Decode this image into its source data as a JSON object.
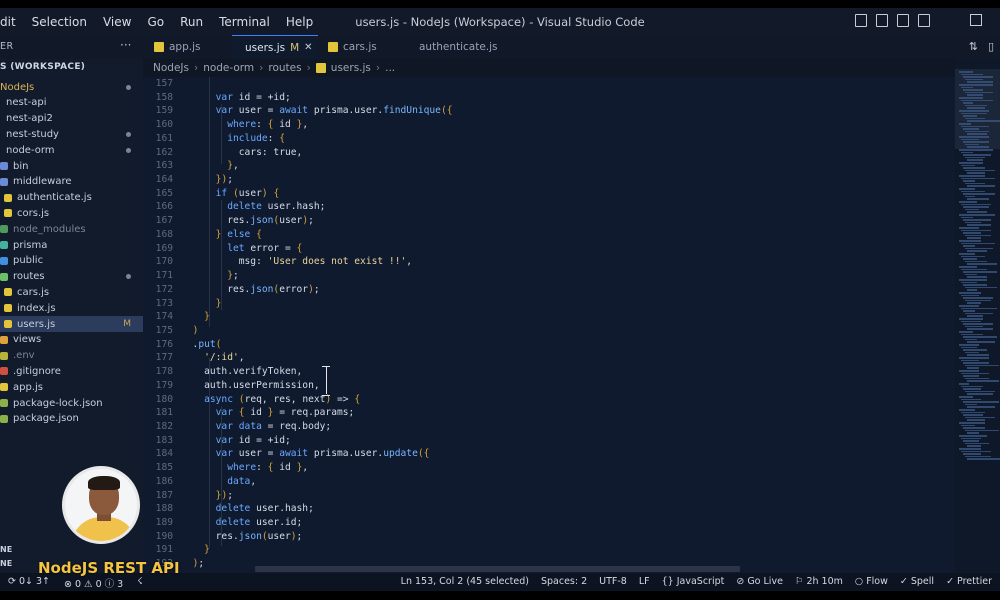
{
  "window": {
    "title": "users.js - NodeJs (Workspace) - Visual Studio Code"
  },
  "menu": [
    "dit",
    "Selection",
    "View",
    "Go",
    "Run",
    "Terminal",
    "Help"
  ],
  "explorer": {
    "title": "ER",
    "more": "···",
    "workspace_header": "S (WORKSPACE)",
    "items": [
      {
        "label": "NodeJs",
        "indicator": "dot",
        "color": "#d9b45a"
      },
      {
        "label": "nest-api"
      },
      {
        "label": "nest-api2"
      },
      {
        "label": "nest-study",
        "indicator": "dot"
      },
      {
        "label": "node-orm",
        "indicator": "dot"
      },
      {
        "label": "bin",
        "icon": "#6a8cd6"
      },
      {
        "label": "middleware",
        "icon": "#6a8cd6"
      },
      {
        "label": "authenticate.js",
        "icon": "#e2c53b"
      },
      {
        "label": "cors.js",
        "icon": "#e2c53b"
      },
      {
        "label": "node_modules",
        "icon": "#4f9a5c",
        "dim": true
      },
      {
        "label": "prisma",
        "icon": "#43b0a0"
      },
      {
        "label": "public",
        "icon": "#3f90e0"
      },
      {
        "label": "routes",
        "indicator": "dot",
        "icon": "#6cc06a"
      },
      {
        "label": "cars.js",
        "icon": "#e2c53b"
      },
      {
        "label": "index.js",
        "icon": "#e2c53b"
      },
      {
        "label": "users.js",
        "icon": "#e2c53b",
        "badge": "M",
        "selected": true
      },
      {
        "label": "views",
        "icon": "#e0a040"
      },
      {
        "label": ".env",
        "icon": "#b8b33b",
        "dim": true
      },
      {
        "label": ".gitignore",
        "icon": "#d05040"
      },
      {
        "label": "app.js",
        "icon": "#e2c53b"
      },
      {
        "label": "package-lock.json",
        "icon": "#8bb14a"
      },
      {
        "label": "package.json",
        "icon": "#8bb14a"
      }
    ],
    "bottom_labels": [
      "NE",
      "NE"
    ]
  },
  "tabs": [
    {
      "label": "app.js"
    },
    {
      "label": "users.js",
      "modified": "M",
      "active": true
    },
    {
      "label": "cars.js"
    },
    {
      "label": "authenticate.js"
    }
  ],
  "breadcrumb": [
    "NodeJs",
    "node-orm",
    "routes",
    "users.js",
    "..."
  ],
  "editor": {
    "lines": [
      {
        "n": "157",
        "code": ""
      },
      {
        "n": "158",
        "code": "      var id = +id;"
      },
      {
        "n": "159",
        "code": "      var user = await prisma.user.findUnique({"
      },
      {
        "n": "160",
        "code": "        where: { id },"
      },
      {
        "n": "161",
        "code": "        include: {"
      },
      {
        "n": "162",
        "code": "          cars: true,"
      },
      {
        "n": "163",
        "code": "        },"
      },
      {
        "n": "164",
        "code": "      });"
      },
      {
        "n": "165",
        "code": "      if (user) {"
      },
      {
        "n": "166",
        "code": "        delete user.hash;"
      },
      {
        "n": "167",
        "code": "        res.json(user);"
      },
      {
        "n": "168",
        "code": "      } else {"
      },
      {
        "n": "169",
        "code": "        let error = {"
      },
      {
        "n": "170",
        "code": "          msg: 'User does not exist !!',"
      },
      {
        "n": "171",
        "code": "        };"
      },
      {
        "n": "172",
        "code": "        res.json(error);"
      },
      {
        "n": "173",
        "code": "      }"
      },
      {
        "n": "174",
        "code": "    }"
      },
      {
        "n": "175",
        "code": "  )"
      },
      {
        "n": "176",
        "code": "  .put("
      },
      {
        "n": "177",
        "code": "    '/:id',"
      },
      {
        "n": "178",
        "code": "    auth.verifyToken,"
      },
      {
        "n": "179",
        "code": "    auth.userPermission,"
      },
      {
        "n": "180",
        "code": "    async (req, res, next) => {"
      },
      {
        "n": "181",
        "code": "      var { id } = req.params;"
      },
      {
        "n": "182",
        "code": "      var data = req.body;"
      },
      {
        "n": "183",
        "code": "      var id = +id;"
      },
      {
        "n": "184",
        "code": "      var user = await prisma.user.update({"
      },
      {
        "n": "185",
        "code": "        where: { id },"
      },
      {
        "n": "186",
        "code": "        data,"
      },
      {
        "n": "187",
        "code": "      });"
      },
      {
        "n": "188",
        "code": "      delete user.hash;"
      },
      {
        "n": "189",
        "code": "      delete user.id;"
      },
      {
        "n": "190",
        "code": "      res.json(user);"
      },
      {
        "n": "191",
        "code": "    }"
      },
      {
        "n": "192",
        "code": "  );"
      }
    ]
  },
  "statusbar": {
    "left": [
      "⟳ 0↓ 3↑",
      "⊗ 0 ⚠ 0 ⓘ 3",
      "☇"
    ],
    "right": [
      "Ln 153, Col 2 (45 selected)",
      "Spaces: 2",
      "UTF-8",
      "LF",
      "{} JavaScript",
      "⊘ Go Live",
      "⚐ 2h 10m",
      "○ Flow",
      "✓ Spell",
      "✓ Prettier"
    ]
  },
  "overlay": {
    "title": "NodeJS REST API"
  }
}
